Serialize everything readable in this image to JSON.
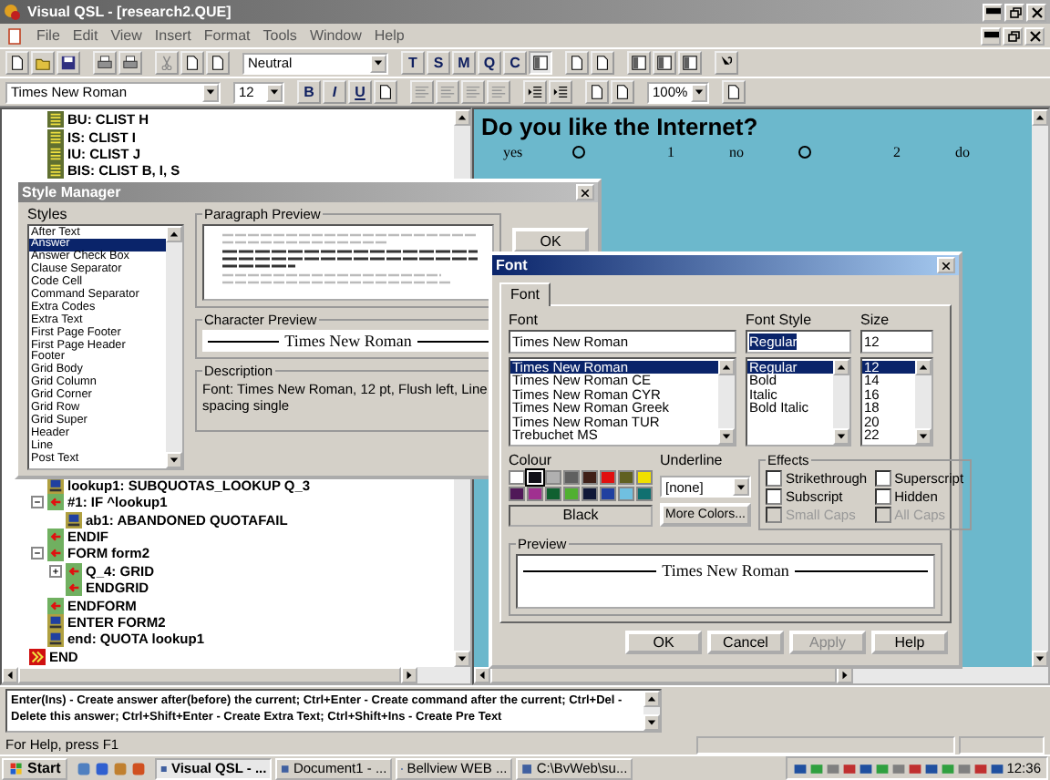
{
  "window": {
    "title": "Visual QSL - [research2.QUE]"
  },
  "menu": [
    "File",
    "Edit",
    "View",
    "Insert",
    "Format",
    "Tools",
    "Window",
    "Help"
  ],
  "toolbar": {
    "style_select": "Neutral",
    "mode_buttons": [
      "T",
      "S",
      "M",
      "Q",
      "C"
    ]
  },
  "format_bar": {
    "font_select": "Times New Roman",
    "size_select": "12",
    "style_buttons": [
      "B",
      "I",
      "U"
    ],
    "zoom_select": "100%"
  },
  "tree": {
    "upper_items": [
      {
        "label": "BU: CLIST H",
        "kind": "list"
      },
      {
        "label": "IS: CLIST I",
        "kind": "list"
      },
      {
        "label": "IU: CLIST J",
        "kind": "list"
      },
      {
        "label": "BIS: CLIST B, I, S",
        "kind": "list"
      }
    ],
    "lower_items": [
      {
        "label": "lookup1: SUBQUOTAS_LOOKUP Q_3",
        "kind": "computer"
      },
      {
        "label": "#1: IF ^lookup1",
        "kind": "arrow",
        "expanded": true,
        "children": [
          {
            "label": "ab1: ABANDONED QUOTAFAIL",
            "kind": "computer"
          }
        ]
      },
      {
        "label": "ENDIF",
        "kind": "arrow"
      },
      {
        "label": "FORM form2",
        "kind": "arrow",
        "expanded": true,
        "children": [
          {
            "label": "Q_4: GRID",
            "kind": "arrow",
            "expanded": false
          },
          {
            "label": "ENDGRID",
            "kind": "arrow"
          }
        ]
      },
      {
        "label": "ENDFORM",
        "kind": "arrow"
      },
      {
        "label": "ENTER FORM2",
        "kind": "computer"
      },
      {
        "label": "end: QUOTA lookup1",
        "kind": "computer"
      }
    ],
    "root_items": [
      {
        "label": "END",
        "kind": "end"
      }
    ]
  },
  "question": {
    "text": "Do you like the Internet?",
    "answers": [
      {
        "label": "yes",
        "code": "1",
        "selected": false
      },
      {
        "label": "no",
        "code": "2",
        "selected": false
      },
      {
        "label": "do"
      }
    ]
  },
  "style_manager": {
    "title": "Style Manager",
    "styles_label": "Styles",
    "styles": [
      {
        "label": "After Text",
        "selected": false
      },
      {
        "label": "Answer",
        "selected": true
      },
      {
        "label": "Answer Check Box",
        "selected": false
      },
      {
        "label": "Clause Separator",
        "selected": false
      },
      {
        "label": "Code Cell",
        "selected": false
      },
      {
        "label": "Command Separator",
        "selected": false
      },
      {
        "label": "Extra Codes",
        "selected": false
      },
      {
        "label": "Extra Text",
        "selected": false
      },
      {
        "label": "First Page Footer",
        "selected": false
      },
      {
        "label": "First Page Header",
        "selected": false
      },
      {
        "label": "Footer",
        "selected": false
      },
      {
        "label": "Grid Body",
        "selected": false
      },
      {
        "label": "Grid Column",
        "selected": false
      },
      {
        "label": "Grid Corner",
        "selected": false
      },
      {
        "label": "Grid Row",
        "selected": false
      },
      {
        "label": "Grid Super",
        "selected": false
      },
      {
        "label": "Header",
        "selected": false
      },
      {
        "label": "Line",
        "selected": false
      },
      {
        "label": "Post Text",
        "selected": false
      }
    ],
    "paragraph_preview_label": "Paragraph Preview",
    "character_preview_label": "Character Preview",
    "character_preview": "Times New Roman",
    "description_label": "Description",
    "description": "Font: Times New Roman, 12 pt, Flush left, Line spacing single",
    "ok": "OK"
  },
  "font_dialog": {
    "title": "Font",
    "tabs": [
      {
        "label": "Font",
        "selected": true
      }
    ],
    "font_label": "Font",
    "font_value": "Times New Roman",
    "fonts": [
      {
        "label": "Times New Roman",
        "selected": true
      },
      {
        "label": "Times New Roman CE",
        "selected": false
      },
      {
        "label": "Times New Roman CYR",
        "selected": false
      },
      {
        "label": "Times New Roman Greek",
        "selected": false
      },
      {
        "label": "Times New Roman TUR",
        "selected": false
      },
      {
        "label": "Trebuchet MS",
        "selected": false
      }
    ],
    "style_label": "Font Style",
    "style_value": "Regular",
    "styles": [
      {
        "label": "Regular",
        "selected": true
      },
      {
        "label": "Bold",
        "selected": false
      },
      {
        "label": "Italic",
        "selected": false
      },
      {
        "label": "Bold Italic",
        "selected": false
      }
    ],
    "size_label": "Size",
    "size_value": "12",
    "sizes": [
      {
        "label": "12",
        "selected": true
      },
      {
        "label": "14",
        "selected": false
      },
      {
        "label": "16",
        "selected": false
      },
      {
        "label": "18",
        "selected": false
      },
      {
        "label": "20",
        "selected": false
      },
      {
        "label": "22",
        "selected": false
      }
    ],
    "colour_label": "Colour",
    "colours": [
      {
        "color": "#ffffff",
        "selected": false
      },
      {
        "color": "#101018",
        "selected": true
      },
      {
        "color": "#b0b0b0",
        "selected": false
      },
      {
        "color": "#606060",
        "selected": false
      },
      {
        "color": "#402018",
        "selected": false
      },
      {
        "color": "#e01010",
        "selected": false
      },
      {
        "color": "#606020",
        "selected": false
      },
      {
        "color": "#f0e000",
        "selected": false
      },
      {
        "color": "#501858",
        "selected": false
      },
      {
        "color": "#a03090",
        "selected": false
      },
      {
        "color": "#106030",
        "selected": false
      },
      {
        "color": "#50b030",
        "selected": false
      },
      {
        "color": "#101838",
        "selected": false
      },
      {
        "color": "#2040a0",
        "selected": false
      },
      {
        "color": "#70c0e0",
        "selected": false
      },
      {
        "color": "#107070",
        "selected": false
      }
    ],
    "colour_name": "Black",
    "underline_label": "Underline",
    "underline_value": "[none]",
    "more_colors": "More Colors...",
    "effects_label": "Effects",
    "effects": [
      {
        "label": "Strikethrough",
        "checked": false,
        "disabled": false
      },
      {
        "label": "Superscript",
        "checked": false,
        "disabled": false
      },
      {
        "label": "Subscript",
        "checked": false,
        "disabled": false
      },
      {
        "label": "Hidden",
        "checked": false,
        "disabled": false
      },
      {
        "label": "Small Caps",
        "checked": false,
        "disabled": true
      },
      {
        "label": "All Caps",
        "checked": false,
        "disabled": true
      }
    ],
    "preview_label": "Preview",
    "preview": "Times New Roman",
    "buttons": [
      {
        "label": "OK",
        "disabled": false
      },
      {
        "label": "Cancel",
        "disabled": false
      },
      {
        "label": "Apply",
        "disabled": true
      },
      {
        "label": "Help",
        "disabled": false
      }
    ]
  },
  "hint": "Enter(Ins) - Create answer after(before) the current; Ctrl+Enter - Create command after the current; Ctrl+Del - Delete this answer; Ctrl+Shift+Enter - Create Extra Text; Ctrl+Shift+Ins - Create Pre Text",
  "status_bar": "For Help, press F1",
  "taskbar": {
    "start": "Start",
    "tasks": [
      {
        "label": "Visual QSL - ...",
        "selected": true
      },
      {
        "label": "Document1 - ...",
        "selected": false
      },
      {
        "label": "Bellview WEB ...",
        "selected": false
      },
      {
        "label": "C:\\BvWeb\\su...",
        "selected": false
      }
    ],
    "clock": "12:36"
  }
}
